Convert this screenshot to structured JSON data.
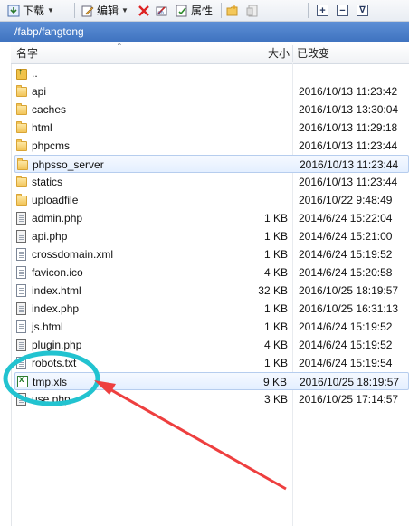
{
  "toolbar": {
    "download_label": "下载",
    "edit_label": "编辑",
    "properties_label": "属性",
    "expand_label": "+",
    "collapse_label": "−",
    "filter_label": "∇"
  },
  "path": "/fabp/fangtong",
  "columns": {
    "name": "名字",
    "size": "大小",
    "modified": "已改变"
  },
  "files": [
    {
      "name": "..",
      "size": "",
      "date": "",
      "type": "up"
    },
    {
      "name": "api",
      "size": "",
      "date": "2016/10/13 11:23:42",
      "type": "folder"
    },
    {
      "name": "caches",
      "size": "",
      "date": "2016/10/13 13:30:04",
      "type": "folder"
    },
    {
      "name": "html",
      "size": "",
      "date": "2016/10/13 11:29:18",
      "type": "folder"
    },
    {
      "name": "phpcms",
      "size": "",
      "date": "2016/10/13 11:23:44",
      "type": "folder"
    },
    {
      "name": "phpsso_server",
      "size": "",
      "date": "2016/10/13 11:23:44",
      "type": "folder"
    },
    {
      "name": "statics",
      "size": "",
      "date": "2016/10/13 11:23:44",
      "type": "folder"
    },
    {
      "name": "uploadfile",
      "size": "",
      "date": "2016/10/22 9:48:49",
      "type": "folder"
    },
    {
      "name": "admin.php",
      "size": "1 KB",
      "date": "2014/6/24 15:22:04",
      "type": "php"
    },
    {
      "name": "api.php",
      "size": "1 KB",
      "date": "2014/6/24 15:21:00",
      "type": "php"
    },
    {
      "name": "crossdomain.xml",
      "size": "1 KB",
      "date": "2014/6/24 15:19:52",
      "type": "doc"
    },
    {
      "name": "favicon.ico",
      "size": "4 KB",
      "date": "2014/6/24 15:20:58",
      "type": "doc"
    },
    {
      "name": "index.html",
      "size": "32 KB",
      "date": "2016/10/25 18:19:57",
      "type": "doc"
    },
    {
      "name": "index.php",
      "size": "1 KB",
      "date": "2016/10/25 16:31:13",
      "type": "php"
    },
    {
      "name": "js.html",
      "size": "1 KB",
      "date": "2014/6/24 15:19:52",
      "type": "doc"
    },
    {
      "name": "plugin.php",
      "size": "4 KB",
      "date": "2014/6/24 15:19:52",
      "type": "php"
    },
    {
      "name": "robots.txt",
      "size": "1 KB",
      "date": "2014/6/24 15:19:54",
      "type": "doc"
    },
    {
      "name": "tmp.xls",
      "size": "9 KB",
      "date": "2016/10/25 18:19:57",
      "type": "xls"
    },
    {
      "name": "use.php",
      "size": "3 KB",
      "date": "2016/10/25 17:14:57",
      "type": "php"
    }
  ],
  "selected_rows": [
    "phpsso_server",
    "tmp.xls"
  ],
  "colors": {
    "pathbar": "#4a7fcc",
    "annotation": "#ee3f3f",
    "highlight_ellipse": "#22c3d0"
  }
}
